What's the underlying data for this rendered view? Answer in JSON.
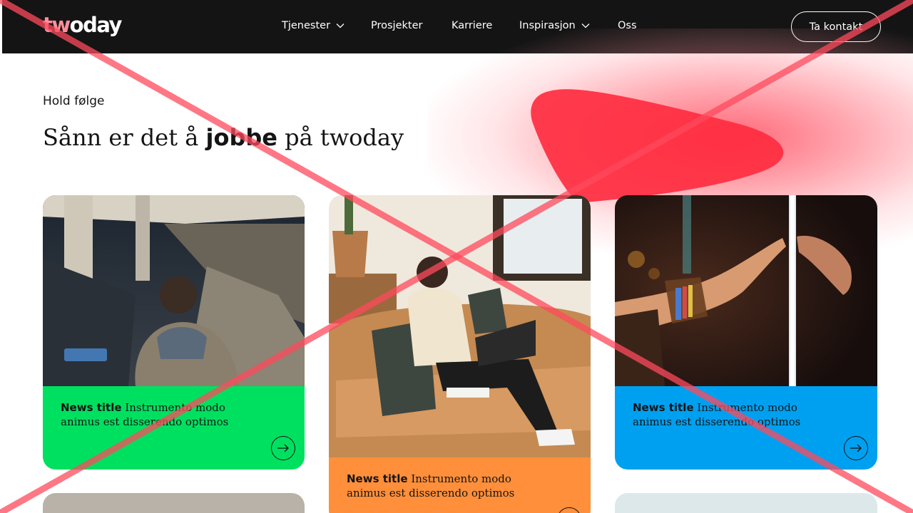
{
  "header": {
    "logo_prefix": "tw",
    "logo_suffix": "oday",
    "nav": [
      {
        "label": "Tjenester",
        "has_dropdown": true
      },
      {
        "label": "Prosjekter",
        "has_dropdown": false
      },
      {
        "label": "Karriere",
        "has_dropdown": false
      },
      {
        "label": "Inspirasjon",
        "has_dropdown": true
      },
      {
        "label": "Oss",
        "has_dropdown": false
      }
    ],
    "contact_label": "Ta kontakt"
  },
  "hero": {
    "eyebrow": "Hold følge",
    "title_before": "Sånn er det å ",
    "title_bold": "jobbe",
    "title_after": " på twoday"
  },
  "cards": [
    {
      "title": "News title",
      "text": " Instrumento modo animus est disserendo optimos",
      "color": "#00e060",
      "image": "photo-man-escalator"
    },
    {
      "title": "News title",
      "text": " Instrumento modo animus est disserendo optimos",
      "color": "#ff8f3a",
      "image": "photo-man-sofa-laptop"
    },
    {
      "title": "News title",
      "text": " Instrumento modo animus est disserendo optimos",
      "color": "#00a0f0",
      "image": "photo-hands-neon"
    }
  ],
  "theme": {
    "header_bg": "#141414",
    "accent_red": "#ff2d40",
    "overlay_x_color": "#ff4a5c"
  }
}
